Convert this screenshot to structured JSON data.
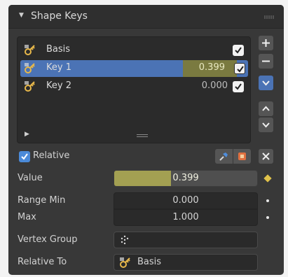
{
  "panel": {
    "title": "Shape Keys"
  },
  "shape_keys": [
    {
      "name": "Basis",
      "value": "",
      "checked": true,
      "selected": false
    },
    {
      "name": "Key 1",
      "value": "0.399",
      "checked": true,
      "selected": true
    },
    {
      "name": "Key 2",
      "value": "0.000",
      "checked": true,
      "selected": false
    }
  ],
  "side_buttons": {
    "add": "+",
    "remove": "−"
  },
  "relative": {
    "label": "Relative",
    "checked": true
  },
  "value": {
    "label": "Value",
    "display": "0.399",
    "fraction": 0.399
  },
  "range_min": {
    "label": "Range Min",
    "value": "0.000"
  },
  "range_max": {
    "label": "Max",
    "value": "1.000"
  },
  "vertex_group": {
    "label": "Vertex Group",
    "value": ""
  },
  "relative_to": {
    "label": "Relative To",
    "value": "Basis"
  },
  "colors": {
    "panel_bg": "#383838",
    "selected_row": "#4b73b5",
    "value_fill": "#a3a052",
    "checkbox_blue": "#4b8ad8",
    "keyframe_diamond": "#e0c24a"
  },
  "icons": {
    "shape_key": "shape-key-icon",
    "pin": "pin-icon",
    "edit_mode": "edit-mode-icon",
    "vertex_group": "vertex-group-icon"
  }
}
